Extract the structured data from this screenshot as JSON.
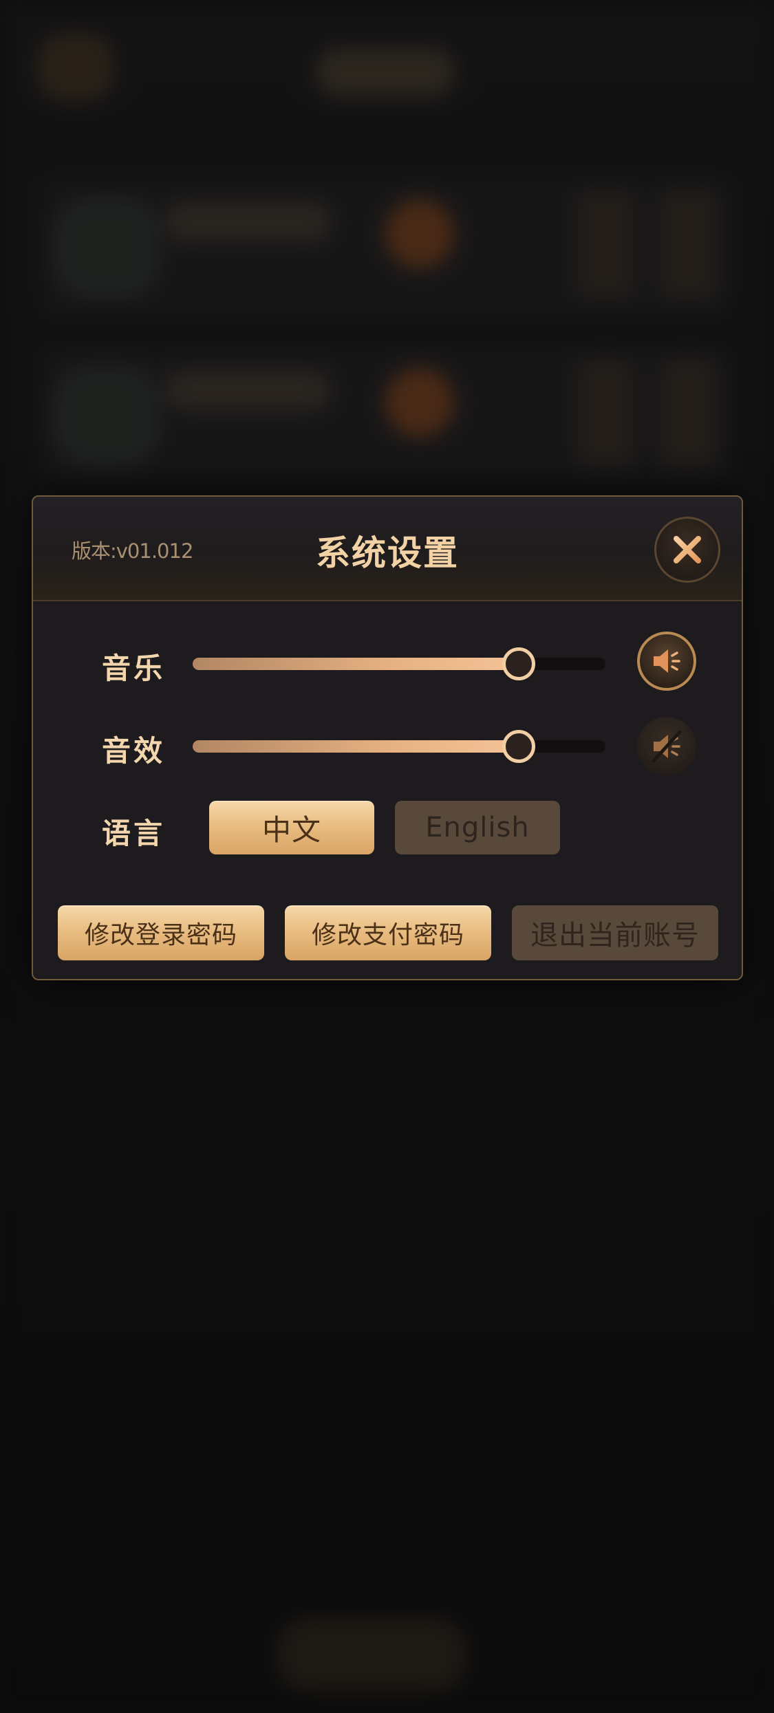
{
  "dialog": {
    "version": "版本:v01.012",
    "title": "系统设置",
    "close_icon": "close-icon"
  },
  "music": {
    "label": "音乐",
    "level_percent": 79,
    "sound_state": "on",
    "icon": "speaker-icon"
  },
  "effects": {
    "label": "音效",
    "level_percent": 79,
    "sound_state": "muted",
    "icon": "speaker-muted-icon"
  },
  "language": {
    "label": "语言",
    "options": [
      {
        "label": "中文",
        "selected": true
      },
      {
        "label": "English",
        "selected": false
      }
    ]
  },
  "actions": {
    "change_login_password": "修改登录密码",
    "change_payment_password": "修改支付密码",
    "logout": "退出当前账号"
  },
  "colors": {
    "accent_gold": "#e6b87c",
    "title_text": "#f3d3a6",
    "panel_bg": "#1d1b1e",
    "disabled_button": "#58493b"
  }
}
